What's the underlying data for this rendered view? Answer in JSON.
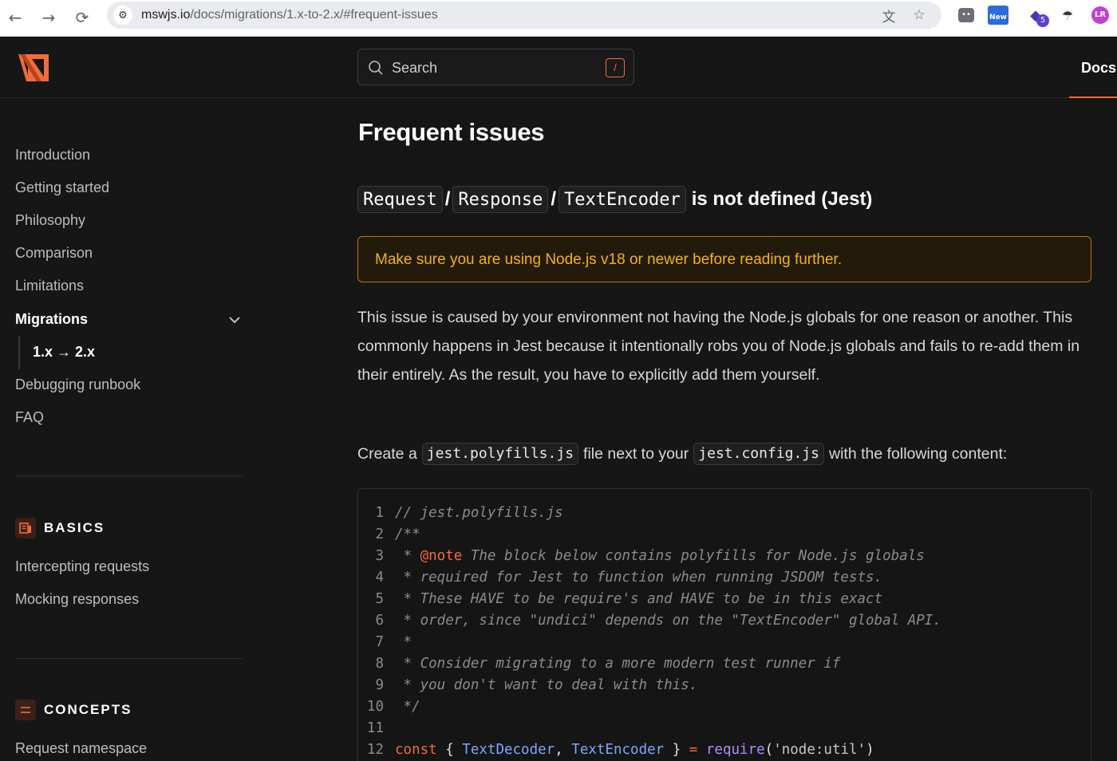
{
  "browser": {
    "url_host": "mswjs.io",
    "url_path": "/docs/migrations/1.x-to-2.x/#frequent-issues",
    "extensions": {
      "new_label": "New",
      "grad_badge": "5",
      "avatar_label": "LR"
    }
  },
  "header": {
    "search_placeholder": "Search",
    "search_shortcut": "/",
    "docs_tab": "Docs",
    "accent": "#f26b3a"
  },
  "sidebar": {
    "items": [
      {
        "label": "Introduction"
      },
      {
        "label": "Getting started"
      },
      {
        "label": "Philosophy"
      },
      {
        "label": "Comparison"
      },
      {
        "label": "Limitations"
      },
      {
        "label": "Migrations"
      }
    ],
    "sub_item": "1.x → 2.x",
    "after_items": [
      {
        "label": "Debugging runbook"
      },
      {
        "label": "FAQ"
      }
    ],
    "sections": [
      {
        "title": "BASICS",
        "icon": "newspaper-icon",
        "items": [
          {
            "label": "Intercepting requests"
          },
          {
            "label": "Mocking responses"
          }
        ]
      },
      {
        "title": "CONCEPTS",
        "icon": "menu-icon",
        "items": [
          {
            "label": "Request namespace"
          }
        ]
      }
    ]
  },
  "main": {
    "title": "Frequent issues",
    "heading": {
      "codes": [
        "Request",
        "Response",
        "TextEncoder"
      ],
      "separator": "/",
      "rest": "is not defined (Jest)"
    },
    "callout": "Make sure you are using Node.js v18 or newer before reading further.",
    "paragraph": "This issue is caused by your environment not having the Node.js globals for one reason or another. This commonly happens in Jest because it intentionally robs you of Node.js globals and fails to re-add them in their entirely. As the result, you have to explicitly add them yourself.",
    "create": {
      "t1": "Create a",
      "code1": "jest.polyfills.js",
      "t2": "file next to your",
      "code2": "jest.config.js",
      "t3": "with the following content:"
    },
    "code_lines": [
      {
        "n": "1",
        "text": "// jest.polyfills.js"
      },
      {
        "n": "2",
        "text": "/**"
      },
      {
        "n": "3",
        "pre": " * ",
        "tag": "@note",
        "text": " The block below contains polyfills for Node.js globals"
      },
      {
        "n": "4",
        "text": " * required for Jest to function when running JSDOM tests."
      },
      {
        "n": "5",
        "text": " * These HAVE to be require's and HAVE to be in this exact"
      },
      {
        "n": "6",
        "text": " * order, since \"undici\" depends on the \"TextEncoder\" global API."
      },
      {
        "n": "7",
        "text": " *"
      },
      {
        "n": "8",
        "text": " * Consider migrating to a more modern test runner if"
      },
      {
        "n": "9",
        "text": " * you don't want to deal with this."
      },
      {
        "n": "10",
        "text": " */"
      },
      {
        "n": "11",
        "text": ""
      },
      {
        "n": "12",
        "kw": "const",
        "p1": " { ",
        "id1": "TextDecoder",
        "p2": ", ",
        "id2": "TextEncoder",
        "p3": " } ",
        "op": "=",
        "p4": " ",
        "fn": "require",
        "p5": "(",
        "str": "'node:util'",
        "p6": ")"
      }
    ]
  }
}
